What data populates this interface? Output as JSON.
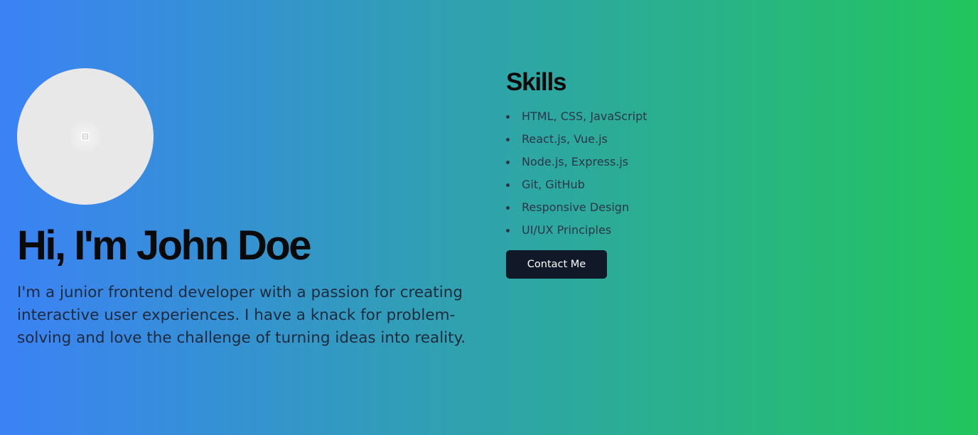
{
  "profile": {
    "avatar_icon": "image-placeholder-icon",
    "title": "Hi, I'm John Doe",
    "bio": "I'm a junior frontend developer with a passion for creating interactive user experiences. I have a knack for problem-solving and love the challenge of turning ideas into reality."
  },
  "skills": {
    "heading": "Skills",
    "items": [
      "HTML, CSS, JavaScript",
      "React.js, Vue.js",
      "Node.js, Express.js",
      "Git, GitHub",
      "Responsive Design",
      "UI/UX Principles"
    ],
    "contact_label": "Contact Me"
  },
  "colors": {
    "gradient_start": "#3b82f6",
    "gradient_end": "#22c55e",
    "button_bg": "#111827",
    "heading_text": "#0a0a0a"
  }
}
